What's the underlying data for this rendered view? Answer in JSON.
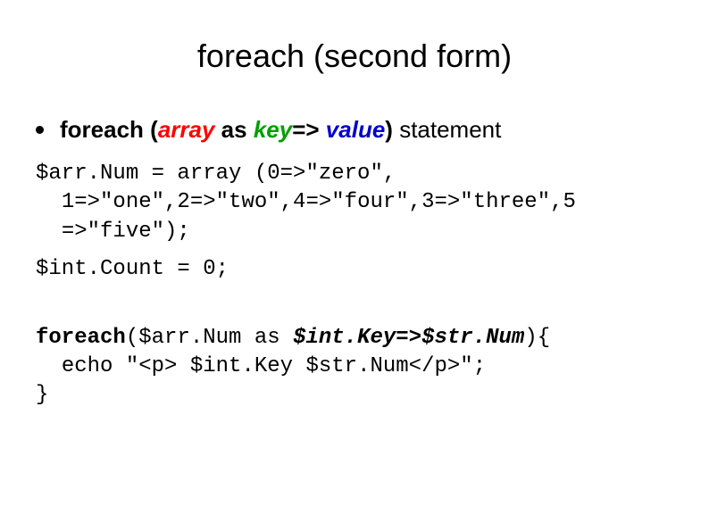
{
  "title": "foreach (second form)",
  "bullet": {
    "p1": "foreach (",
    "p2": "array",
    "p3": " as ",
    "p4": "key",
    "p5": "=> ",
    "p6": "value",
    "p7": ")",
    "p8": " statement"
  },
  "code": {
    "block1": "$arr.Num = array (0=>\"zero\",\n  1=>\"one\",2=>\"two\",4=>\"four\",3=>\"three\",5\n  =>\"five\");",
    "block2": "$int.Count = 0;",
    "b3": {
      "s1": "foreach",
      "s2": "($arr.Num as ",
      "s3": "$int.Key=>$str.Num",
      "s4": "){",
      "s5": "  echo \"<p> $int.Key $str.Num</p>\";",
      "s6": "}"
    }
  }
}
